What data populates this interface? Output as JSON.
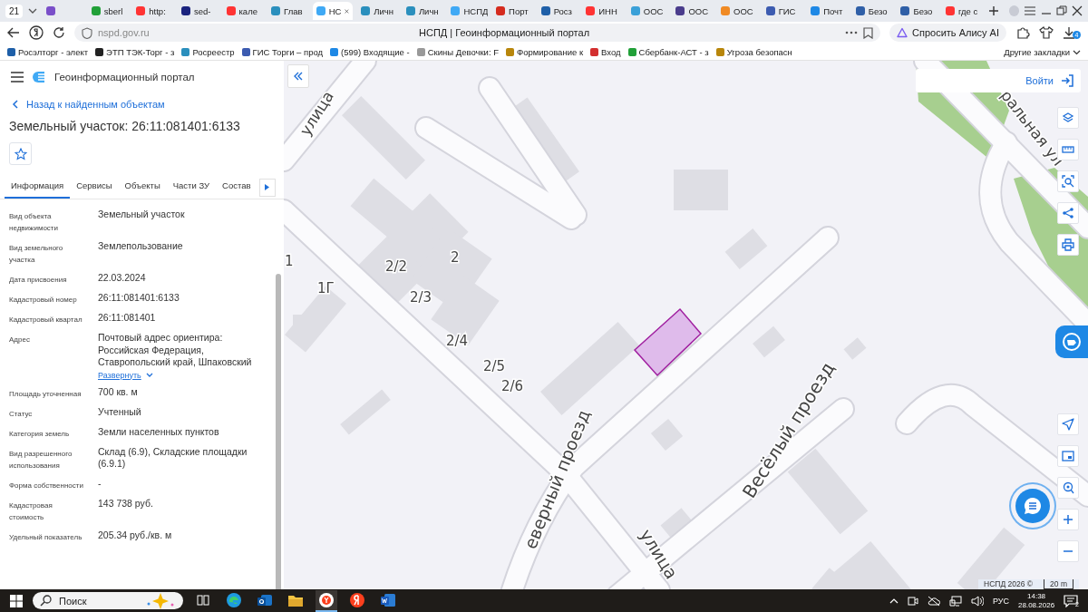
{
  "browser": {
    "tab_count": "21",
    "tabs": [
      {
        "color": "#7a4fc9",
        "selected": false
      },
      {
        "label": "sberl",
        "color": "#21a038",
        "selected": false
      },
      {
        "label": "http:",
        "color": "#f33",
        "selected": false
      },
      {
        "label": "sed-",
        "color": "#1a237e",
        "selected": false
      },
      {
        "label": "кале",
        "color": "#f33",
        "selected": false
      },
      {
        "label": "Глав",
        "color": "#2a8fbd",
        "selected": false
      },
      {
        "label": "НС",
        "color": "#3fa9f5",
        "selected": true
      },
      {
        "label": "Личн",
        "color": "#2a8fbd",
        "selected": false
      },
      {
        "label": "Личн",
        "color": "#2a8fbd",
        "selected": false
      },
      {
        "label": "НСПД",
        "color": "#3fa9f5",
        "selected": false
      },
      {
        "label": "Порт",
        "color": "#d52b1e",
        "selected": false
      },
      {
        "label": "Росз",
        "color": "#1e5fa8",
        "selected": false
      },
      {
        "label": "ИНН",
        "color": "#f33",
        "selected": false
      },
      {
        "label": "ООС",
        "color": "#3aa0d8",
        "selected": false
      },
      {
        "label": "ООС",
        "color": "#4a3c8c",
        "selected": false
      },
      {
        "label": "ООС",
        "color": "#f08a24",
        "selected": false
      },
      {
        "label": "ГИС",
        "color": "#3c5bb0",
        "selected": false
      },
      {
        "label": "Почт",
        "color": "#1e88e5",
        "selected": false
      },
      {
        "label": "Безо",
        "color": "#2f5fa7",
        "selected": false
      },
      {
        "label": "Безо",
        "color": "#2f5fa7",
        "selected": false
      },
      {
        "label": "где с",
        "color": "#f33",
        "selected": false
      }
    ],
    "url": "nspd.gov.ru",
    "page_title": "НСПД | Геоинформационный портал",
    "alice_button": "Спросить Алису AI",
    "downloads_badge": "4",
    "bookmarks": [
      {
        "label": "Росэлторг - элект",
        "color": "#1e5fa8"
      },
      {
        "label": "ЭТП ТЭК-Торг - з",
        "color": "#222"
      },
      {
        "label": "Росреестр",
        "color": "#2a8fbd"
      },
      {
        "label": "ГИС Торги – прод",
        "color": "#3c5bb0"
      },
      {
        "label": "(599) Входящие -",
        "color": "#1e88e5"
      },
      {
        "label": "Скины Девочки: F",
        "color": "#999"
      },
      {
        "label": "Формирование к",
        "color": "#b8860b"
      },
      {
        "label": "Вход",
        "color": "#d32f2f"
      },
      {
        "label": "Сбербанк-АСТ - з",
        "color": "#21a038"
      },
      {
        "label": "Угроза безопасн",
        "color": "#b8860b"
      }
    ],
    "other_bookmarks": "Другие закладки"
  },
  "portal": {
    "title": "Геоинформационный портал",
    "back_link": "Назад к найденным объектам",
    "object_title": "Земельный участок: 26:11:081401:6133",
    "tabs": [
      {
        "label": "Информация",
        "selected": true
      },
      {
        "label": "Сервисы",
        "selected": false
      },
      {
        "label": "Объекты",
        "selected": false
      },
      {
        "label": "Части ЗУ",
        "selected": false
      },
      {
        "label": "Состав",
        "selected": false
      }
    ],
    "details": [
      {
        "label": "Вид объекта недвижимости",
        "value": "Земельный участок"
      },
      {
        "label": "Вид земельного участка",
        "value": "Землепользование"
      },
      {
        "label": "Дата присвоения",
        "value": "22.03.2024"
      },
      {
        "label": "Кадастровый номер",
        "value": "26:11:081401:6133"
      },
      {
        "label": "Кадастровый квартал",
        "value": "26:11:081401"
      },
      {
        "label": "Адрес",
        "value": "Почтовый адрес ориентира: Российская Федерация, Ставропольский край, Шпаковский",
        "expand_link": "Развернуть"
      },
      {
        "label": "Площадь уточненная",
        "value": "700 кв. м"
      },
      {
        "label": "Статус",
        "value": "Учтенный"
      },
      {
        "label": "Категория земель",
        "value": "Земли населенных пунктов"
      },
      {
        "label": "Вид разрешенного использования",
        "value": "Склад (6.9), Складские площадки (6.9.1)"
      },
      {
        "label": "Форма собственности",
        "value": "-"
      },
      {
        "label": "Кадастровая стоимость",
        "value": "143 738 руб."
      },
      {
        "label": "Удельный показатель",
        "value": "205.34 руб./кв. м"
      }
    ]
  },
  "map": {
    "login_button": "Войти",
    "labels": [
      "улица",
      "ральная ул",
      "1",
      "1Г",
      "2/2",
      "2",
      "2/3",
      "2/4",
      "2/5",
      "2/6",
      "еверный проезд",
      "Весёлый проезд",
      "улица"
    ],
    "attribution": "НСПД 2026 ©",
    "scale": "20 m"
  },
  "taskbar": {
    "search": "Поиск",
    "apps": [
      {
        "kind": "taskview",
        "selected": false
      },
      {
        "kind": "edge",
        "selected": false
      },
      {
        "kind": "outlook",
        "selected": false
      },
      {
        "kind": "explorer",
        "selected": false
      },
      {
        "kind": "yabrowser",
        "selected": true
      },
      {
        "kind": "yandex",
        "selected": false
      },
      {
        "kind": "word",
        "selected": false
      }
    ],
    "language": "РУС",
    "time": "14:38",
    "date": "28.08.2026",
    "notifications": "2"
  }
}
